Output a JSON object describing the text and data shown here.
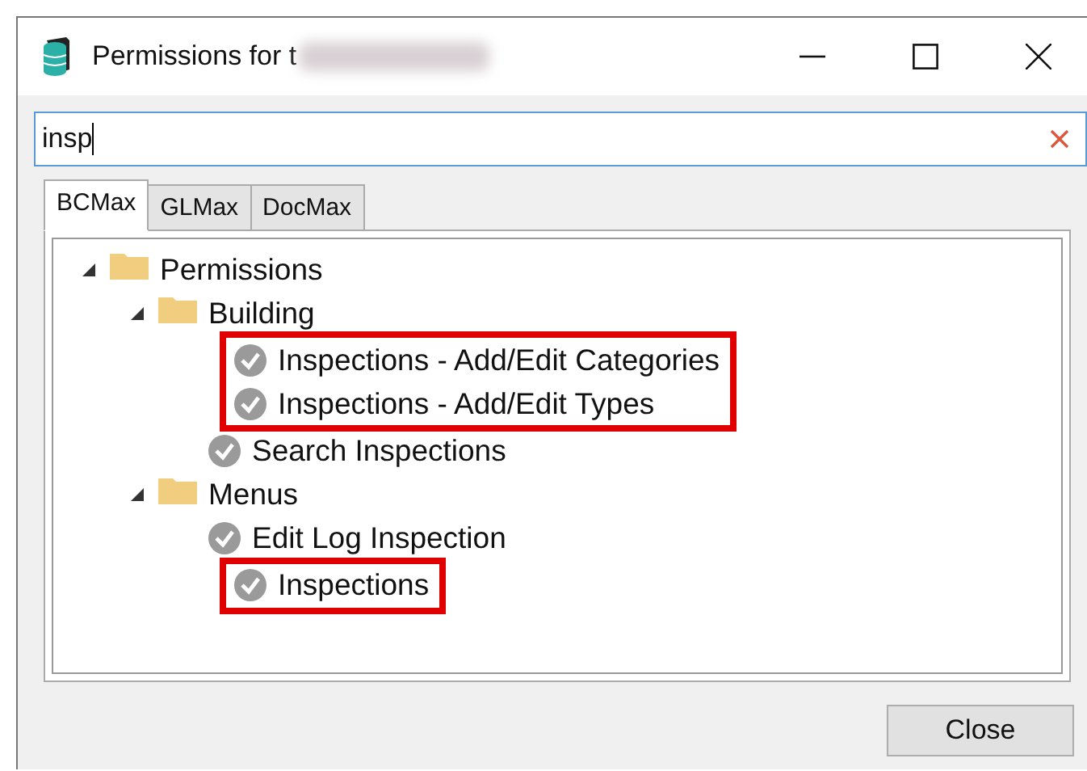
{
  "window": {
    "title": "Permissions for t"
  },
  "search": {
    "value": "insp"
  },
  "tabs": [
    {
      "label": "BCMax",
      "selected": true
    },
    {
      "label": "GLMax",
      "selected": false
    },
    {
      "label": "DocMax",
      "selected": false
    }
  ],
  "tree": [
    {
      "kind": "folder",
      "label": "Permissions",
      "expanded": true,
      "children": [
        {
          "kind": "folder",
          "label": "Building",
          "expanded": true,
          "children": [
            {
              "kind": "permission",
              "label": "Inspections - Add/Edit Categories",
              "highlighted": true
            },
            {
              "kind": "permission",
              "label": "Inspections - Add/Edit Types",
              "highlighted": true
            },
            {
              "kind": "permission",
              "label": "Search Inspections",
              "highlighted": false
            }
          ]
        },
        {
          "kind": "folder",
          "label": "Menus",
          "expanded": true,
          "children": [
            {
              "kind": "permission",
              "label": "Edit Log Inspection",
              "highlighted": false
            },
            {
              "kind": "permission",
              "label": "Inspections",
              "highlighted": true
            }
          ]
        }
      ]
    }
  ],
  "buttons": [
    "Close"
  ]
}
